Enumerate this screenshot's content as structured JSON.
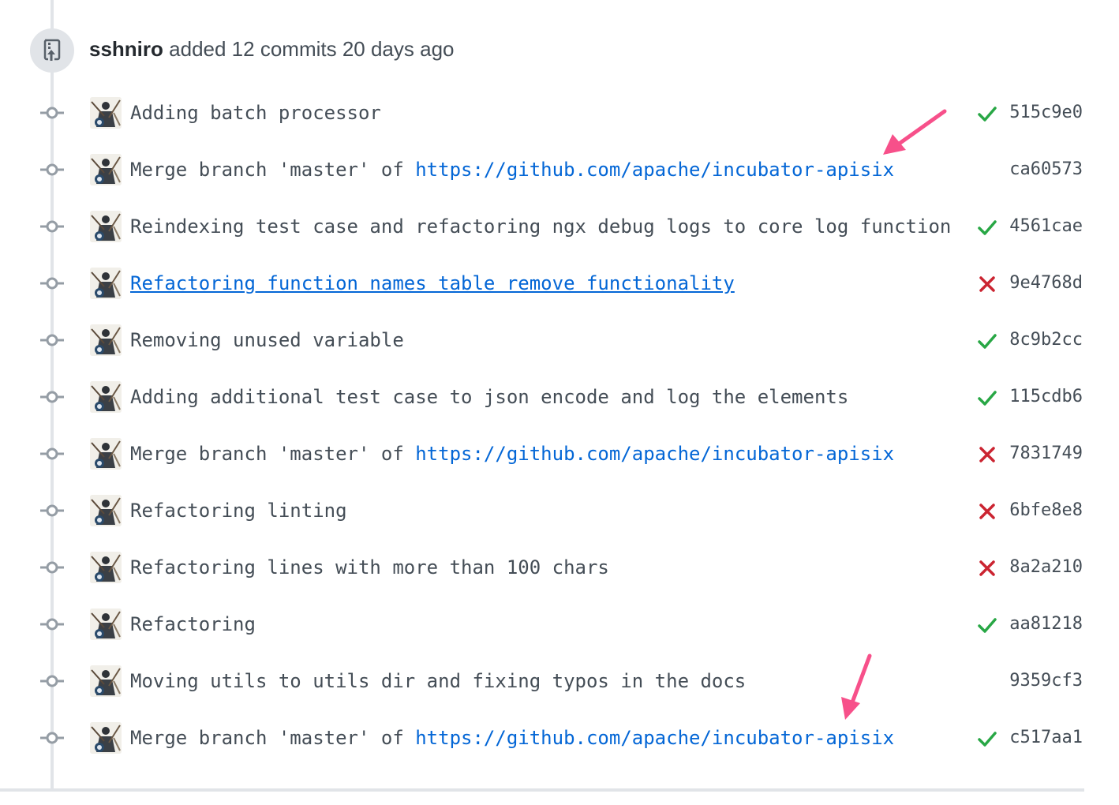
{
  "event": {
    "author": "sshniro",
    "action_text": "added 12 commits 20 days ago",
    "icon": "repo-push-icon"
  },
  "commits": [
    {
      "message": "Adding batch processor",
      "link_text": "",
      "underlined": false,
      "status": "success",
      "sha": "515c9e0"
    },
    {
      "message": "Merge branch 'master' of ",
      "link_text": "https://github.com/apache/incubator-apisix",
      "underlined": false,
      "status": "none",
      "sha": "ca60573"
    },
    {
      "message": "Reindexing test case and refactoring ngx debug logs to core log function",
      "link_text": "",
      "underlined": false,
      "status": "success",
      "sha": "4561cae"
    },
    {
      "message": "Refactoring function names table remove functionality",
      "link_text": "",
      "underlined": true,
      "status": "failure",
      "sha": "9e4768d"
    },
    {
      "message": "Removing unused variable",
      "link_text": "",
      "underlined": false,
      "status": "success",
      "sha": "8c9b2cc"
    },
    {
      "message": "Adding additional test case to json encode and log the elements",
      "link_text": "",
      "underlined": false,
      "status": "success",
      "sha": "115cdb6"
    },
    {
      "message": "Merge branch 'master' of ",
      "link_text": "https://github.com/apache/incubator-apisix",
      "underlined": false,
      "status": "failure",
      "sha": "7831749"
    },
    {
      "message": "Refactoring linting",
      "link_text": "",
      "underlined": false,
      "status": "failure",
      "sha": "6bfe8e8"
    },
    {
      "message": "Refactoring lines with more than 100 chars",
      "link_text": "",
      "underlined": false,
      "status": "failure",
      "sha": "8a2a210"
    },
    {
      "message": "Refactoring",
      "link_text": "",
      "underlined": false,
      "status": "success",
      "sha": "aa81218"
    },
    {
      "message": "Moving utils to utils dir and fixing typos in the docs",
      "link_text": "",
      "underlined": false,
      "status": "none",
      "sha": "9359cf3"
    },
    {
      "message": "Merge branch 'master' of ",
      "link_text": "https://github.com/apache/incubator-apisix",
      "underlined": false,
      "status": "success",
      "sha": "c517aa1"
    }
  ],
  "colors": {
    "success": "#28a745",
    "failure": "#cb2431",
    "link": "#0366d6",
    "annotation_arrow": "#f7508a"
  },
  "annotations": {
    "arrows": [
      {
        "points_to": "commits.1.link_text"
      },
      {
        "points_to": "commits.11.link_text"
      }
    ]
  }
}
